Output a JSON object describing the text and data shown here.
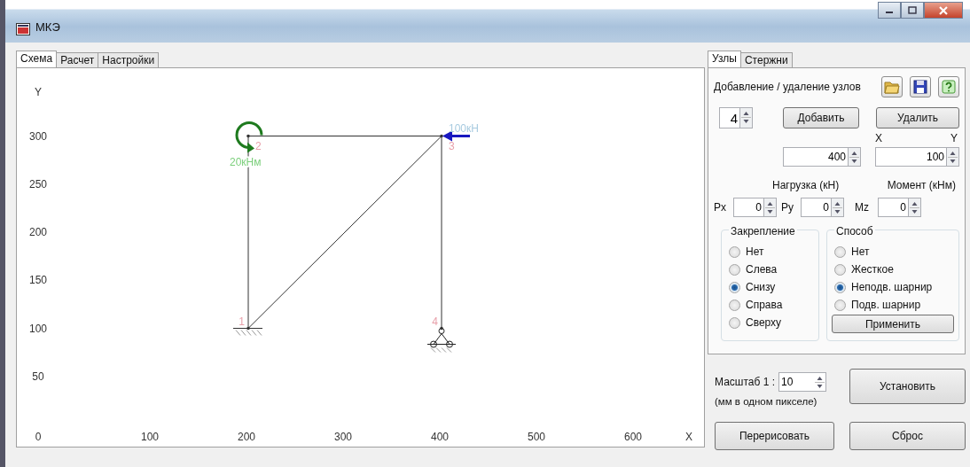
{
  "window": {
    "title": "МКЭ"
  },
  "left_tabs": [
    {
      "label": "Схема",
      "selected": true
    },
    {
      "label": "Расчет",
      "selected": false
    },
    {
      "label": "Настройки",
      "selected": false
    }
  ],
  "scheme": {
    "axis_y": "Y",
    "y_ticks": [
      "300",
      "250",
      "200",
      "150",
      "100",
      "50"
    ],
    "x_ticks": [
      "0",
      "100",
      "200",
      "300",
      "400",
      "500",
      "600"
    ],
    "axis_x": "X",
    "nodes": [
      {
        "label": "1",
        "kind": "fixed"
      },
      {
        "label": "2",
        "kind": "free",
        "load": {
          "kind": "moment",
          "label": "20кНм",
          "color": "#1e7a1e"
        }
      },
      {
        "label": "3",
        "kind": "free",
        "load": {
          "kind": "force",
          "label": "100кН",
          "color": "#1818c0"
        }
      },
      {
        "label": "4",
        "kind": "pinned"
      }
    ]
  },
  "right_tabs": [
    {
      "label": "Узлы",
      "selected": true
    },
    {
      "label": "Стержни",
      "selected": false
    }
  ],
  "nodes_panel": {
    "heading": "Добавление / удаление узлов",
    "node_number": "4",
    "add_button": "Добавить",
    "delete_button": "Удалить",
    "x_label": "X",
    "y_label": "Y",
    "x_value": "400",
    "y_value": "100",
    "load_label": "Нагрузка (кН)",
    "moment_label": "Момент (кНм)",
    "px_label": "Px",
    "px_value": "0",
    "py_label": "Py",
    "py_value": "0",
    "mz_label": "Mz",
    "mz_value": "0",
    "fixing": {
      "title": "Закрепление",
      "options": [
        {
          "label": "Нет",
          "selected": false
        },
        {
          "label": "Слева",
          "selected": false
        },
        {
          "label": "Снизу",
          "selected": true
        },
        {
          "label": "Справа",
          "selected": false
        },
        {
          "label": "Сверху",
          "selected": false
        }
      ]
    },
    "method": {
      "title": "Способ",
      "options": [
        {
          "label": "Нет",
          "selected": false
        },
        {
          "label": "Жесткое",
          "selected": false
        },
        {
          "label": "Неподв. шарнир",
          "selected": true
        },
        {
          "label": "Подв. шарнир",
          "selected": false
        }
      ],
      "apply_button": "Применить"
    }
  },
  "scale": {
    "label": "Масштаб 1 :",
    "value": "10",
    "hint": "(мм в одном пикселе)",
    "set_button": "Установить"
  },
  "redraw_button": "Перерисовать",
  "reset_button": "Сброс"
}
